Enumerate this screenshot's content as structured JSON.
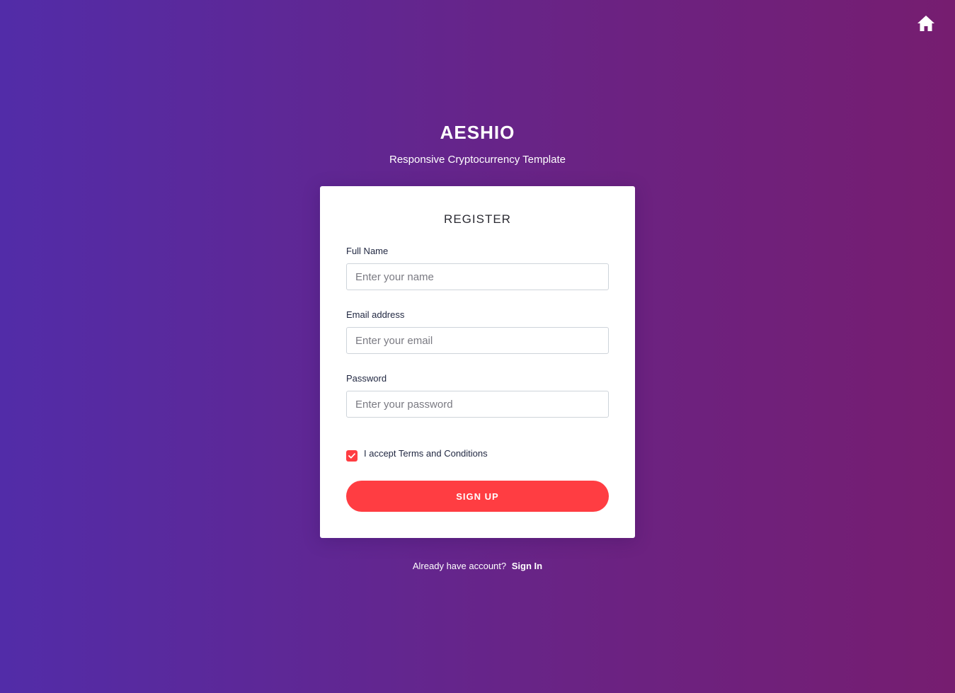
{
  "header": {
    "home_icon": "home-icon"
  },
  "brand": {
    "title": "AESHIO",
    "subtitle": "Responsive Cryptocurrency Template"
  },
  "form": {
    "title": "REGISTER",
    "full_name": {
      "label": "Full Name",
      "placeholder": "Enter your name",
      "value": ""
    },
    "email": {
      "label": "Email address",
      "placeholder": "Enter your email",
      "value": ""
    },
    "password": {
      "label": "Password",
      "placeholder": "Enter your password",
      "value": ""
    },
    "terms": {
      "checked": true,
      "label": "I accept Terms and Conditions"
    },
    "submit_label": "SIGN UP"
  },
  "footer": {
    "prompt": "Already have account?",
    "link_label": "Sign In"
  },
  "colors": {
    "gradient_start": "#522ca8",
    "gradient_end": "#761d70",
    "accent": "#ff3d42",
    "card_bg": "#ffffff"
  }
}
